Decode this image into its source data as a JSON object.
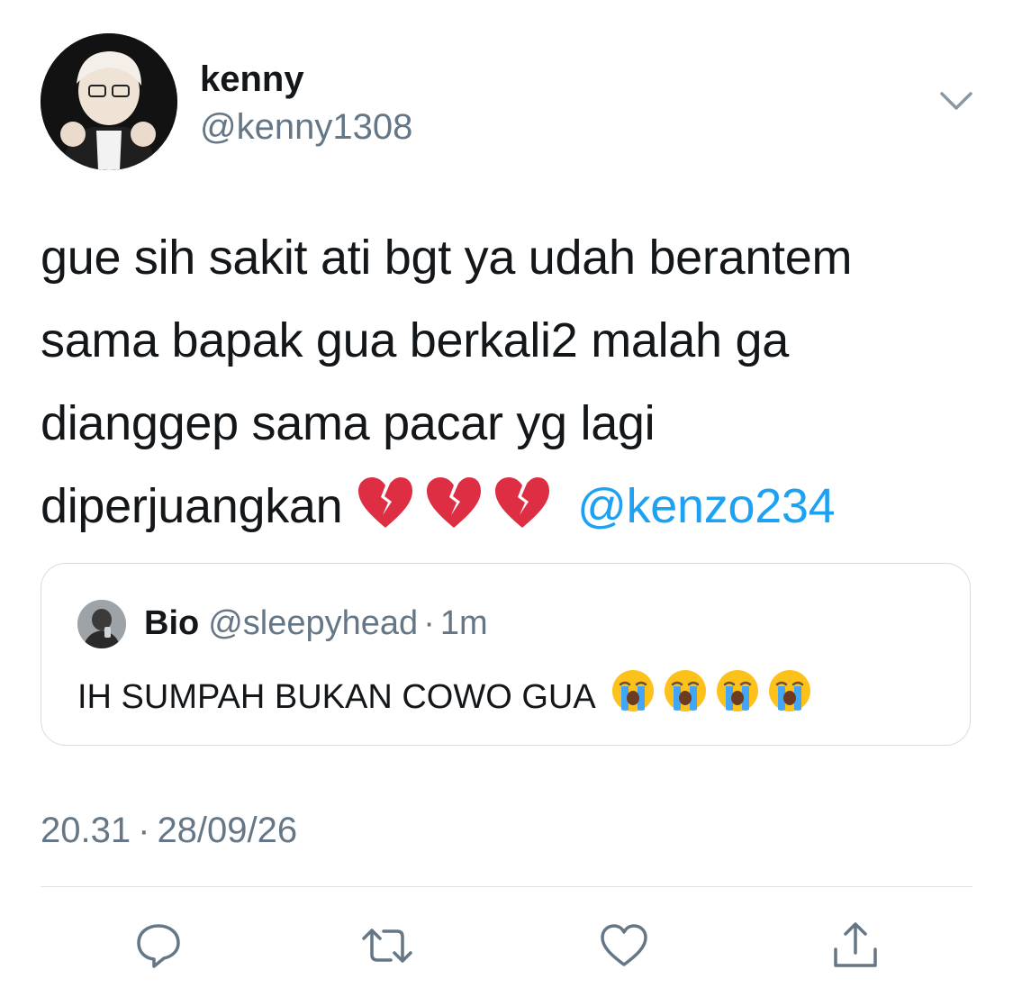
{
  "author": {
    "display_name": "kenny",
    "handle": "@kenny1308"
  },
  "tweet": {
    "lines": [
      "gue sih sakit ati bgt ya udah berantem",
      "sama bapak gua berkali2 malah ga",
      "dianggep sama pacar yg lagi",
      "diperjuangkan"
    ],
    "emoji": "broken-heart-emoji",
    "emoji_count": 3,
    "mention": "@kenzo234"
  },
  "quote": {
    "display_name": "Bio",
    "handle": "@sleepyhead",
    "dot": "·",
    "time": "1m",
    "text": "IH SUMPAH BUKAN COWO GUA",
    "emoji": "loudly-crying-face-emoji",
    "emoji_count": 4
  },
  "meta": {
    "time": "20.31",
    "separator": "·",
    "date": "28/09/26"
  },
  "actions": [
    "reply-icon",
    "retweet-icon",
    "like-icon",
    "share-icon"
  ],
  "colors": {
    "text": "#14171a",
    "secondary": "#657786",
    "link": "#1da1f2",
    "border": "#d5dde3",
    "heart": "#dd2e44",
    "emoji_face": "#fcc21b"
  }
}
